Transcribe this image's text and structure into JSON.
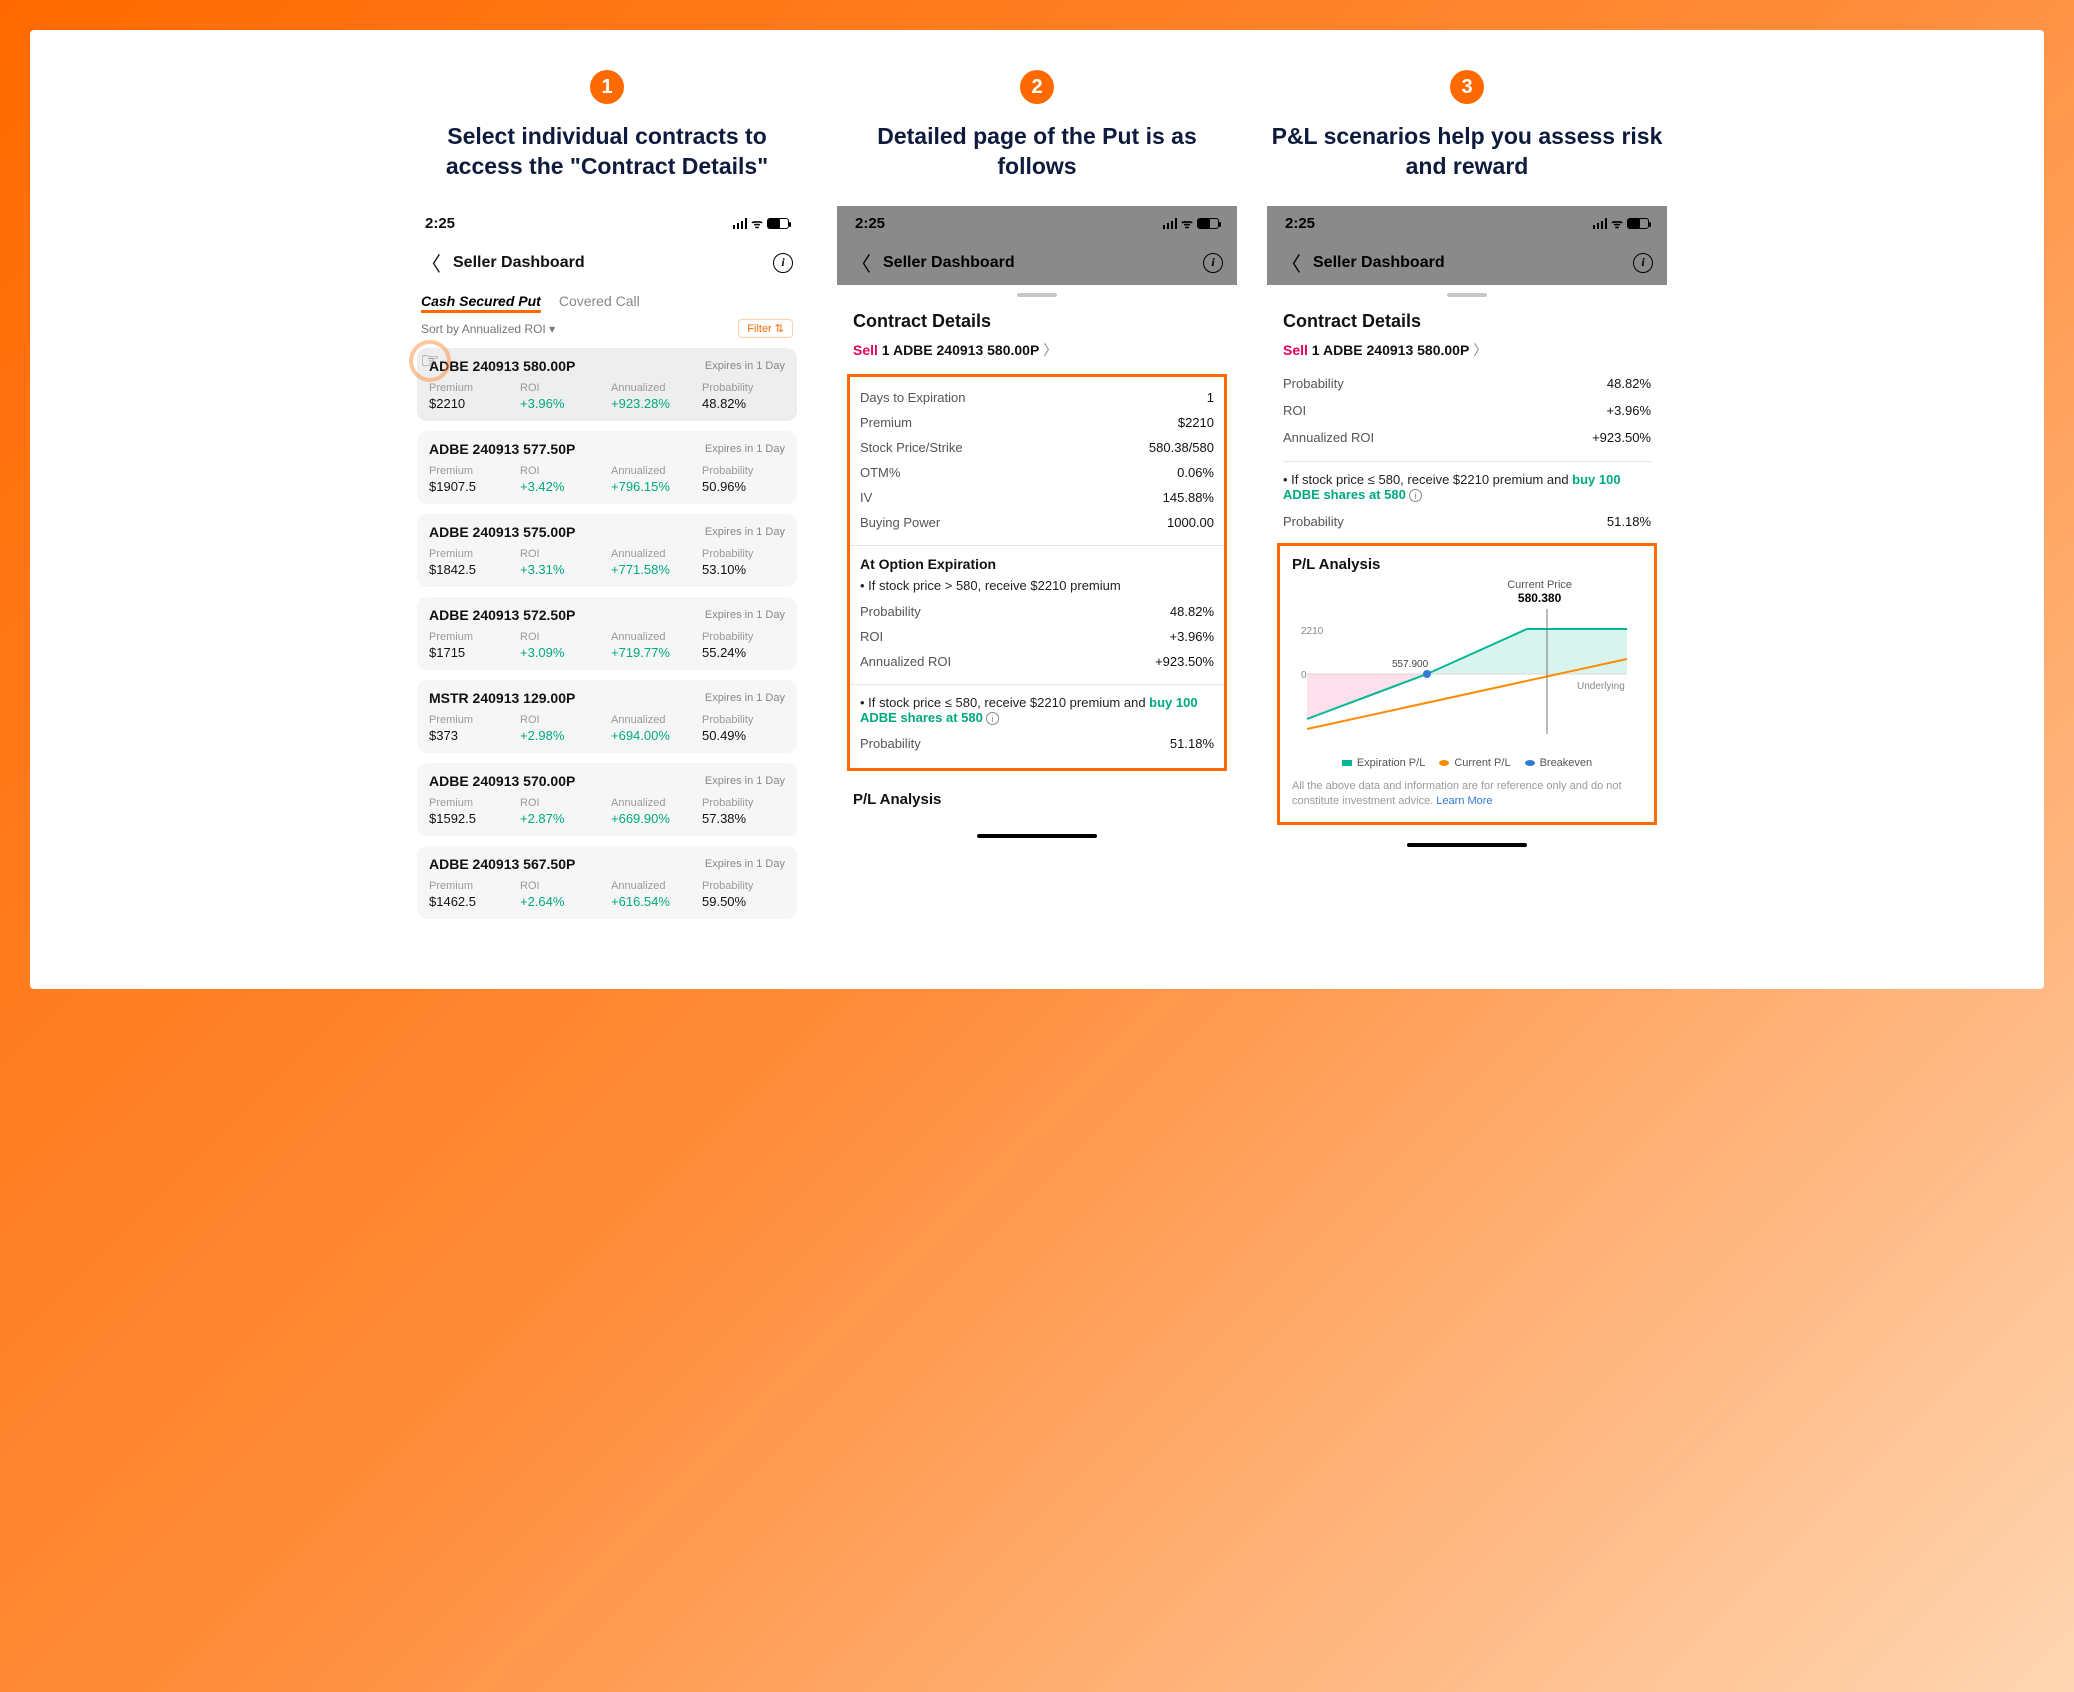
{
  "steps": [
    "1",
    "2",
    "3"
  ],
  "titles": {
    "s1": "Select individual contracts to access the \"Contract Details\"",
    "s2": "Detailed page of the Put is as follows",
    "s3": "P&L scenarios help you assess risk and reward"
  },
  "status": {
    "time": "2:25"
  },
  "nav": {
    "title": "Seller Dashboard"
  },
  "tabs": {
    "csp": "Cash Secured Put",
    "cc": "Covered Call"
  },
  "sort": {
    "label": "Sort by Annualized ROI ▾",
    "filter": "Filter ⇅"
  },
  "metricLabels": {
    "premium": "Premium",
    "roi": "ROI",
    "annualized": "Annualized",
    "probability": "Probability"
  },
  "expires": "Expires in 1 Day",
  "contracts": [
    {
      "sym": "ADBE 240913 580.00P",
      "premium": "$2210",
      "roi": "+3.96%",
      "ann": "+923.28%",
      "prob": "48.82%"
    },
    {
      "sym": "ADBE 240913 577.50P",
      "premium": "$1907.5",
      "roi": "+3.42%",
      "ann": "+796.15%",
      "prob": "50.96%"
    },
    {
      "sym": "ADBE 240913 575.00P",
      "premium": "$1842.5",
      "roi": "+3.31%",
      "ann": "+771.58%",
      "prob": "53.10%"
    },
    {
      "sym": "ADBE 240913 572.50P",
      "premium": "$1715",
      "roi": "+3.09%",
      "ann": "+719.77%",
      "prob": "55.24%"
    },
    {
      "sym": "MSTR 240913 129.00P",
      "premium": "$373",
      "roi": "+2.98%",
      "ann": "+694.00%",
      "prob": "50.49%"
    },
    {
      "sym": "ADBE 240913 570.00P",
      "premium": "$1592.5",
      "roi": "+2.87%",
      "ann": "+669.90%",
      "prob": "57.38%"
    },
    {
      "sym": "ADBE 240913 567.50P",
      "premium": "$1462.5",
      "roi": "+2.64%",
      "ann": "+616.54%",
      "prob": "59.50%"
    }
  ],
  "details": {
    "sectionTitle": "Contract Details",
    "sellWord": "Sell",
    "sellLine": " 1 ADBE 240913 580.00P",
    "rows": {
      "dte_k": "Days to Expiration",
      "dte_v": "1",
      "prem_k": "Premium",
      "prem_v": "$2210",
      "sp_k": "Stock Price/Strike",
      "sp_v": "580.38/580",
      "otm_k": "OTM%",
      "otm_v": "0.06%",
      "iv_k": "IV",
      "iv_v": "145.88%",
      "bp_k": "Buying Power",
      "bp_v": "1000.00"
    },
    "atExp": "At Option Expiration",
    "bullet1": "• If stock price > 580, receive $2210 premium",
    "prob_k": "Probability",
    "prob_v": "48.82%",
    "roi_k": "ROI",
    "roi_v": "+3.96%",
    "aroi_k": "Annualized ROI",
    "aroi_v": "+923.50%",
    "bullet2a": "• If stock price ≤ 580, receive $2210 premium and ",
    "bullet2b": "buy 100 ADBE shares at 580",
    "prob2_v": "51.18%",
    "plTitle": "P/L Analysis"
  },
  "panel3": {
    "prob_k": "Probability",
    "prob_v": "48.82%",
    "roi_k": "ROI",
    "roi_v": "+3.96%",
    "aroi_k": "Annualized ROI",
    "aroi_v": "+923.50%",
    "bullet_a": "• If stock price ≤ 580, receive $2210 premium and ",
    "bullet_b": "buy 100 ADBE shares at 580",
    "prob2_k": "Probability",
    "prob2_v": "51.18%",
    "plTitle": "P/L Analysis",
    "cp_label": "Current Price",
    "cp_val": "580.380",
    "breakeven": "557.900",
    "ymax": "2210",
    "yzero": "0",
    "under": "Underlying",
    "lg_exp": "Expiration P/L",
    "lg_cur": "Current P/L",
    "lg_bre": "Breakeven",
    "disc": "All the above data and information are for reference only and do not constitute investment advice. ",
    "learn": "Learn More"
  },
  "chart_data": {
    "type": "line",
    "title": "P/L Analysis",
    "xlabel": "Underlying",
    "ylabel": "",
    "ylim": [
      -1500,
      2210
    ],
    "current_price": 580.38,
    "breakeven": 557.9,
    "max_profit": 2210,
    "series": [
      {
        "name": "Expiration P/L",
        "points": [
          {
            "x": 530,
            "y": -2800
          },
          {
            "x": 557.9,
            "y": 0
          },
          {
            "x": 580,
            "y": 2210
          },
          {
            "x": 610,
            "y": 2210
          }
        ]
      },
      {
        "name": "Current P/L",
        "points": [
          {
            "x": 530,
            "y": -1200
          },
          {
            "x": 560,
            "y": -200
          },
          {
            "x": 590,
            "y": 700
          },
          {
            "x": 610,
            "y": 1200
          }
        ]
      }
    ],
    "annotations": [
      {
        "label": "Breakeven",
        "x": 557.9,
        "y": 0
      }
    ]
  }
}
